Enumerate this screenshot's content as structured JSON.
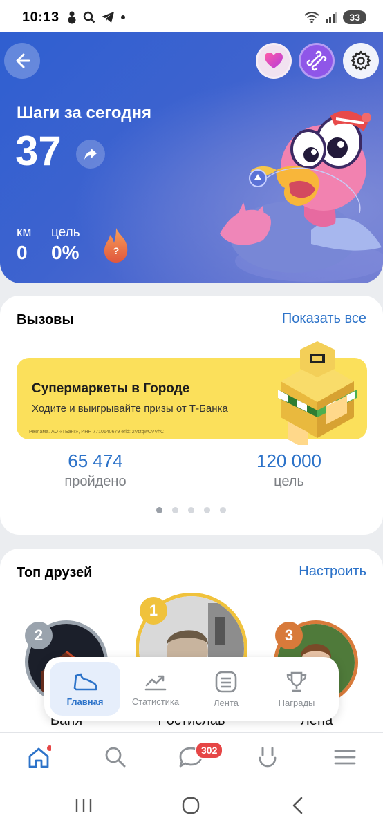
{
  "status_bar": {
    "time": "10:13",
    "battery": "33"
  },
  "hero": {
    "title": "Шаги за сегодня",
    "steps": "37",
    "km_label": "км",
    "km_value": "0",
    "goal_label": "цель",
    "goal_value": "0%",
    "flame_mark": "?"
  },
  "challenges": {
    "title": "Вызовы",
    "link": "Показать все",
    "banner": {
      "title": "Супермаркеты в Городе",
      "subtitle": "Ходите и выигрывайте призы от Т-Банка",
      "ad_note": "Реклама. АО «ТБанк», ИНН 7710140679 erid: 2VtzqwCVVhC"
    },
    "passed_value": "65 474",
    "passed_label": "пройдено",
    "goal_value": "120 000",
    "goal_label": "цель",
    "pages": 5,
    "active_page": 1
  },
  "friends": {
    "title": "Топ друзей",
    "link": "Настроить",
    "people": [
      {
        "rank": "2",
        "name": "Ваня"
      },
      {
        "rank": "1",
        "name": "Ростислав"
      },
      {
        "rank": "3",
        "name": "Лена"
      }
    ]
  },
  "floating_nav": [
    {
      "label": "Главная",
      "icon": "shoe-icon",
      "active": true
    },
    {
      "label": "Статистика",
      "icon": "chart-icon",
      "active": false
    },
    {
      "label": "Лента",
      "icon": "feed-icon",
      "active": false
    },
    {
      "label": "Награды",
      "icon": "trophy-icon",
      "active": false
    }
  ],
  "bottom_nav": {
    "messages_badge": "302"
  },
  "colors": {
    "accent": "#2d73c9",
    "hero_blue": "#3e63cf",
    "banner_yellow": "#fbe05b",
    "gold": "#f0c23c",
    "silver": "#9aa3ad",
    "bronze": "#d87a3a"
  }
}
